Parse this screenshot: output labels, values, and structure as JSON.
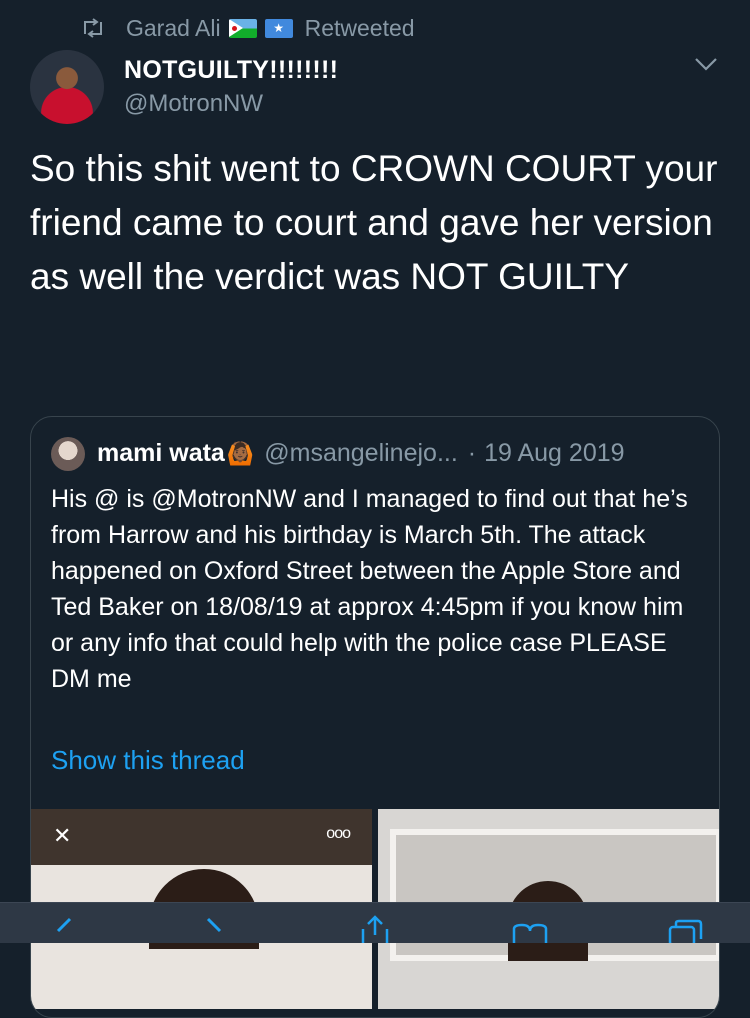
{
  "retweet": {
    "by": "Garad Ali",
    "label": "Retweeted",
    "flag_dj": "djibouti-flag",
    "flag_so_star": "★"
  },
  "tweet": {
    "display_name": "NOTGUILTY!!!!!!!!",
    "handle": "@MotronNW",
    "text": "So this shit went to CROWN COURT your friend came to court and gave her version as well the verdict was NOT GUILTY"
  },
  "quoted": {
    "display_name": "mami wata",
    "emoji": "🙆🏾",
    "handle": "@msangelinejo...",
    "separator": "·",
    "date": "19 Aug 2019",
    "text": "His @ is @MotronNW and I managed to find out that he’s from Harrow and his birthday is March 5th. The attack happened on Oxford Street between the Apple Store and Ted Baker on 18/08/19 at approx 4:45pm if you know him or any info that could help with the police case PLEASE DM me",
    "show_thread": "Show this thread",
    "media": {
      "close_glyph": "✕",
      "more_glyph": "ooo"
    }
  },
  "colors": {
    "background": "#15202b",
    "secondary_text": "#8899a6",
    "link": "#1da1f2",
    "border": "#38444d"
  },
  "toolbar": {
    "icons": [
      "back-icon",
      "forward-icon",
      "share-icon",
      "bookmarks-icon",
      "tabs-icon"
    ]
  }
}
